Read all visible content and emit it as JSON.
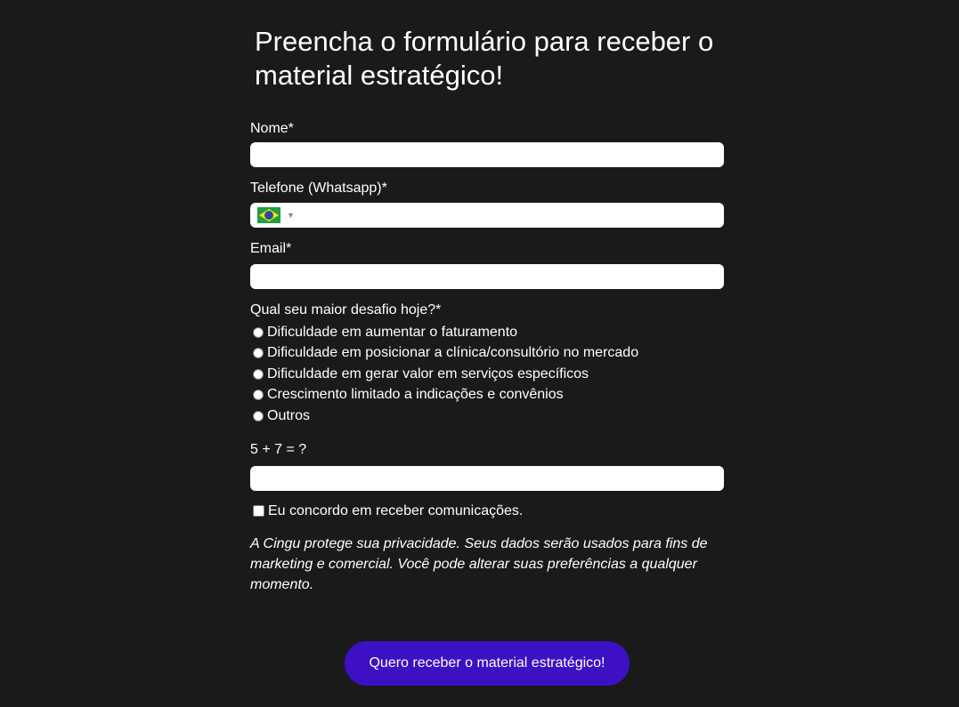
{
  "form": {
    "title": "Preencha o formulário para receber o material estratégico!",
    "name_label": "Nome*",
    "name_value": "",
    "phone_label": "Telefone (Whatsapp)*",
    "phone_country": "brazil-flag-icon",
    "phone_value": "",
    "email_label": "Email*",
    "email_value": "",
    "challenge_label": "Qual seu maior desafio hoje?*",
    "challenge_options": [
      "Dificuldade em aumentar o faturamento",
      "Dificuldade em posicionar a clínica/consultório no mercado",
      "Dificuldade em gerar valor em serviços específicos",
      "Crescimento limitado a indicações e convênios",
      "Outros"
    ],
    "captcha_label": "5 + 7 = ?",
    "captcha_value": "",
    "consent_label": "Eu concordo em receber comunicações.",
    "privacy_text": "A Cingu protege sua privacidade. Seus dados serão usados para fins de marketing e comercial. Você pode alterar suas preferências a qualquer momento.",
    "submit_label": "Quero receber o material estratégico!"
  },
  "colors": {
    "background": "#1a1a1a",
    "button": "#3d10c4",
    "text": "#ffffff"
  }
}
